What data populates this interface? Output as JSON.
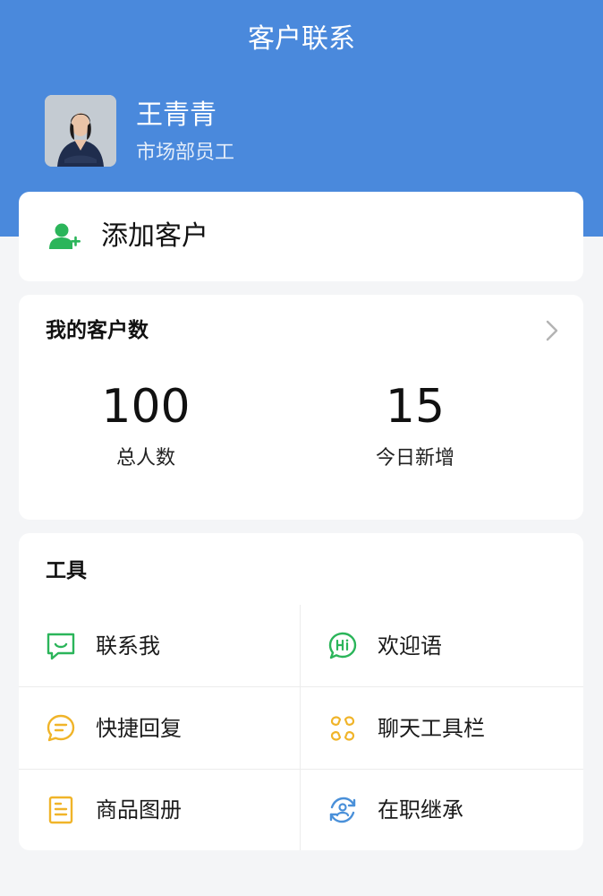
{
  "header": {
    "title": "客户联系",
    "user_name": "王青青",
    "user_role": "市场部员工"
  },
  "add_customer": {
    "label": "添加客户",
    "icon": "add-user-icon"
  },
  "stats": {
    "title": "我的客户数",
    "items": [
      {
        "value": "100",
        "label": "总人数"
      },
      {
        "value": "15",
        "label": "今日新增"
      }
    ]
  },
  "tools": {
    "title": "工具",
    "items": [
      {
        "label": "联系我",
        "icon": "contact-me-icon"
      },
      {
        "label": "欢迎语",
        "icon": "hi-bubble-icon"
      },
      {
        "label": "快捷回复",
        "icon": "quick-reply-icon"
      },
      {
        "label": "聊天工具栏",
        "icon": "chat-toolbar-icon"
      },
      {
        "label": "商品图册",
        "icon": "product-album-icon"
      },
      {
        "label": "在职继承",
        "icon": "inherit-icon"
      }
    ]
  },
  "colors": {
    "header_blue": "#4a89dc",
    "green": "#2bb55a",
    "yellow": "#f0b429",
    "light_blue": "#4a90d9"
  }
}
